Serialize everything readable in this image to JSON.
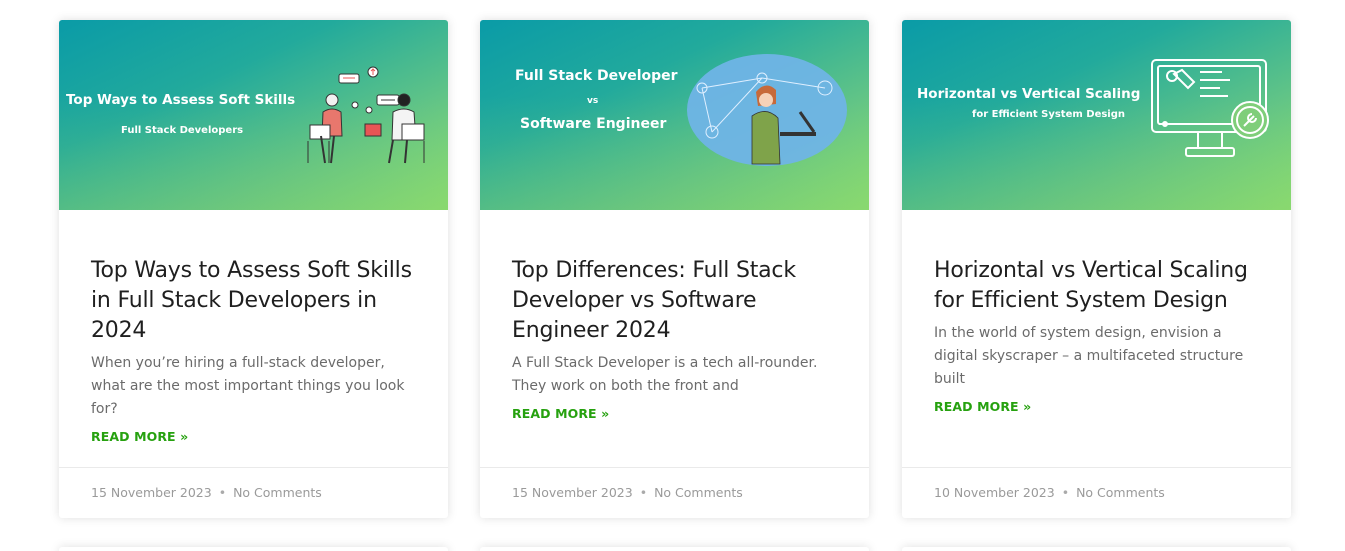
{
  "posts": [
    {
      "thumb_title": "Top Ways to Assess Soft Skills",
      "thumb_subtitle": "Full Stack Developers",
      "title": "Top Ways to Assess Soft Skills in Full Stack Developers in 2024",
      "excerpt": "When you’re hiring a full-stack developer, what are the most important things you look for?",
      "read_more": "READ MORE »",
      "date": "15 November 2023",
      "comments": "No Comments"
    },
    {
      "thumb_title_line1": "Full Stack Developer",
      "thumb_vs": "vs",
      "thumb_title_line2": "Software Engineer",
      "title": "Top Differences: Full Stack Developer vs Software Engineer 2024",
      "excerpt": "A Full Stack Developer is a tech all-rounder. They work on both the front and",
      "read_more": "READ MORE »",
      "date": "15 November 2023",
      "comments": "No Comments"
    },
    {
      "thumb_title": "Horizontal vs Vertical Scaling",
      "thumb_subtitle": "for Efficient System Design",
      "title": "Horizontal vs Vertical Scaling for Efficient System Design",
      "excerpt": "In the world of system design, envision a digital skyscraper – a multifaceted structure built",
      "read_more": "READ MORE »",
      "date": "10 November 2023",
      "comments": "No Comments"
    }
  ],
  "meta_separator": "•",
  "colors": {
    "accent": "#26a10f",
    "thumb_gradient_start": "#0a9ba7",
    "thumb_gradient_end": "#93e26f"
  },
  "icons": [
    "people-talking-illustration",
    "developer-laptop-illustration",
    "monitor-tools-icon"
  ]
}
